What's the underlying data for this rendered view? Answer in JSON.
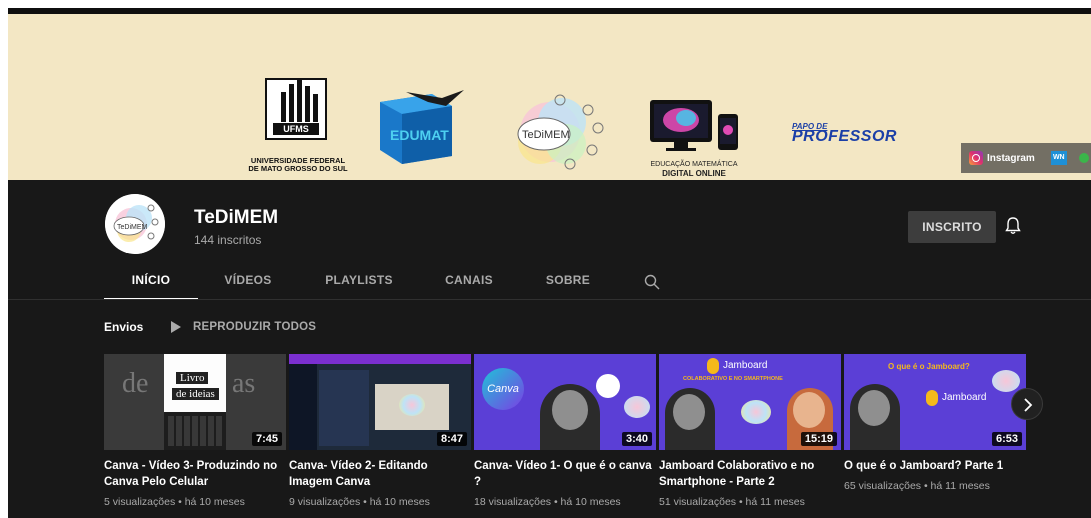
{
  "banner": {
    "ufms_label": "UFMS",
    "ufms_name_line1": "UNIVERSIDADE FEDERAL",
    "ufms_name_line2": "DE MATO GROSSO DO SUL",
    "edumat_label": "EDUMAT",
    "tedimem_label": "TeDiMEM",
    "edm_line1": "EDUCAÇÃO MATEMÁTICA",
    "edm_line2": "DIGITAL ONLINE",
    "papo_line1": "PAPO DE",
    "papo_line2": "PROFESSOR",
    "instagram_label": "Instagram",
    "wn_label": "WN"
  },
  "channel": {
    "name": "TeDiMEM",
    "subscribers": "144 inscritos",
    "avatar_label": "TeDiMEM",
    "subscribe_label": "INSCRITO"
  },
  "tabs": [
    {
      "label": "INÍCIO",
      "active": true
    },
    {
      "label": "VÍDEOS",
      "active": false
    },
    {
      "label": "PLAYLISTS",
      "active": false
    },
    {
      "label": "CANAIS",
      "active": false
    },
    {
      "label": "SOBRE",
      "active": false
    }
  ],
  "section": {
    "title": "Envios",
    "play_all": "REPRODUZIR TODOS"
  },
  "videos": [
    {
      "title": "Canva - Vídeo 3- Produzindo no Canva Pelo Celular",
      "duration": "7:45",
      "meta": "5 visualizações • há 10 meses",
      "thumb_text1": "Livro",
      "thumb_text2": "de ideias"
    },
    {
      "title": "Canva- Vídeo 2- Editando Imagem Canva",
      "duration": "8:47",
      "meta": "9 visualizações • há 10 meses"
    },
    {
      "title": "Canva- Vídeo 1- O que é o canva ?",
      "duration": "3:40",
      "meta": "18 visualizações • há 10 meses",
      "thumb_text1": "Canva"
    },
    {
      "title": "Jamboard Colaborativo e no Smartphone - Parte 2",
      "duration": "15:19",
      "meta": "51 visualizações • há 11 meses",
      "thumb_text1": "Jamboard",
      "thumb_text2": "COLABORATIVO E NO SMARTPHONE"
    },
    {
      "title": "O que é o Jamboard? Parte 1",
      "duration": "6:53",
      "meta": "65 visualizações • há 11 meses",
      "thumb_text1": "O que é o Jamboard?",
      "thumb_text2": "Jamboard"
    }
  ],
  "colors": {
    "background": "#181818",
    "banner": "#f3e7c4",
    "purple_thumb": "#5b3fd6"
  }
}
